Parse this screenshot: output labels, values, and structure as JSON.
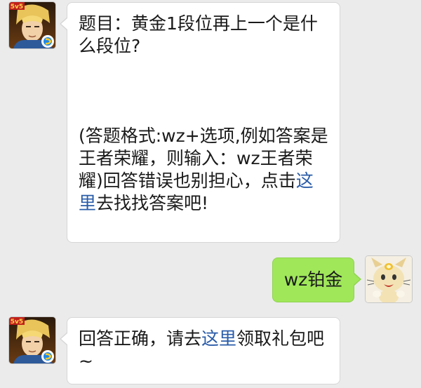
{
  "messages": [
    {
      "sender": "game-account",
      "side": "left",
      "avatar_icon": "game-hero-avatar-icon",
      "question": "题目：黄金1段位再上一个是什么段位?",
      "format_hint": {
        "before_link": "(答题格式:wz+选项,例如答案是王者荣耀，则输入：wz王者荣耀)回答错误也别担心，点击",
        "link": "这里",
        "after_link": "去找找答案吧!"
      }
    },
    {
      "sender": "user",
      "side": "right",
      "avatar_icon": "meowth-avatar-icon",
      "text": "wz铂金"
    },
    {
      "sender": "game-account",
      "side": "left",
      "avatar_icon": "game-hero-avatar-icon",
      "reply": {
        "before_link": "回答正确，请去",
        "link": "这里",
        "after_link": "领取礼包吧~"
      }
    }
  ],
  "colors": {
    "background": "#ebebeb",
    "left_bubble": "#ffffff",
    "right_bubble": "#a0e75a",
    "link": "#2a5ca8"
  }
}
